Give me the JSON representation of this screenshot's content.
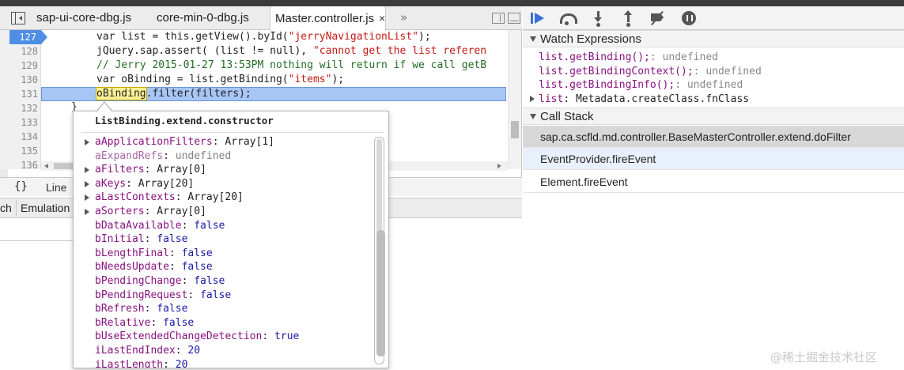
{
  "editor": {
    "tabs": [
      {
        "label": "sap-ui-core-dbg.js"
      },
      {
        "label": "core-min-0-dbg.js"
      },
      {
        "label": "Master.controller.js",
        "active": true,
        "close": "×"
      }
    ],
    "more": "»",
    "lines": [
      {
        "num": "127",
        "breakpoint": true
      },
      {
        "num": "128"
      },
      {
        "num": "129"
      },
      {
        "num": "130"
      },
      {
        "num": "131",
        "execution": true
      },
      {
        "num": "132"
      },
      {
        "num": "133"
      },
      {
        "num": "134"
      },
      {
        "num": "135"
      },
      {
        "num": "136"
      }
    ],
    "code": {
      "l127_a": "var list = this.getView().byId(",
      "l127_str": "\"jerryNavigationList\"",
      "l127_b": ");",
      "l128_a": "jQuery.sap.assert( (list != null), ",
      "l128_str": "\"cannot get the list referen",
      "l129_cmt": "// Jerry 2015-01-27 13:53PM nothing will return if we call getB",
      "l130_a": "var oBinding = list.getBinding(",
      "l130_str": "\"items\"",
      "l130_b": ");",
      "l131_word": "oBinding",
      "l131_rest": ".filter(filters);",
      "l132": "}"
    },
    "status": {
      "braces": "{}",
      "line_label": "Line"
    }
  },
  "drawer": {
    "tab_partial": "ch",
    "tab_emulation": "Emulation"
  },
  "debugger": {
    "watch": {
      "title": "Watch Expressions",
      "items": [
        {
          "expr": "list.getBinding();",
          "value": ": undefined"
        },
        {
          "expr": "list.getBindingContext();",
          "value": ": undefined"
        },
        {
          "expr": "list.getBindingInfo();",
          "value": ": undefined"
        },
        {
          "expr": "list",
          "value": ": Metadata.createClass.fnClass",
          "expandable": true
        }
      ]
    },
    "callstack": {
      "title": "Call Stack",
      "frames": [
        {
          "label": "sap.ca.scfld.md.controller.BaseMasterController.extend.doFilter",
          "state": "selected"
        },
        {
          "label": "EventProvider.fireEvent",
          "state": "hover"
        },
        {
          "label": "Element.fireEvent",
          "state": "normal"
        }
      ]
    }
  },
  "popover": {
    "title": "ListBinding.extend.constructor",
    "props": [
      {
        "name": "aApplicationFilters",
        "value": "Array[1]",
        "kind": "obj",
        "expandable": true
      },
      {
        "name": "aExpandRefs",
        "value": "undefined",
        "kind": "undef",
        "faded": true
      },
      {
        "name": "aFilters",
        "value": "Array[0]",
        "kind": "obj",
        "expandable": true
      },
      {
        "name": "aKeys",
        "value": "Array[20]",
        "kind": "obj",
        "expandable": true
      },
      {
        "name": "aLastContexts",
        "value": "Array[20]",
        "kind": "obj",
        "expandable": true
      },
      {
        "name": "aSorters",
        "value": "Array[0]",
        "kind": "obj",
        "expandable": true
      },
      {
        "name": "bDataAvailable",
        "value": "false",
        "kind": "bool"
      },
      {
        "name": "bInitial",
        "value": "false",
        "kind": "bool"
      },
      {
        "name": "bLengthFinal",
        "value": "false",
        "kind": "bool"
      },
      {
        "name": "bNeedsUpdate",
        "value": "false",
        "kind": "bool"
      },
      {
        "name": "bPendingChange",
        "value": "false",
        "kind": "bool"
      },
      {
        "name": "bPendingRequest",
        "value": "false",
        "kind": "bool"
      },
      {
        "name": "bRefresh",
        "value": "false",
        "kind": "bool"
      },
      {
        "name": "bRelative",
        "value": "false",
        "kind": "bool"
      },
      {
        "name": "bUseExtendedChangeDetection",
        "value": "true",
        "kind": "bool"
      },
      {
        "name": "iLastEndIndex",
        "value": "20",
        "kind": "num"
      },
      {
        "name": "iLastLength",
        "value": "20",
        "kind": "num"
      }
    ]
  },
  "watermark": "@稀土掘金技术社区",
  "colors": {
    "breakpoint": "#4e8fe5",
    "execution_line": "#a8c6f5",
    "property_name": "#881280",
    "literal": "#1a1aa6",
    "string": "#c41a16",
    "comment": "#236e25"
  }
}
